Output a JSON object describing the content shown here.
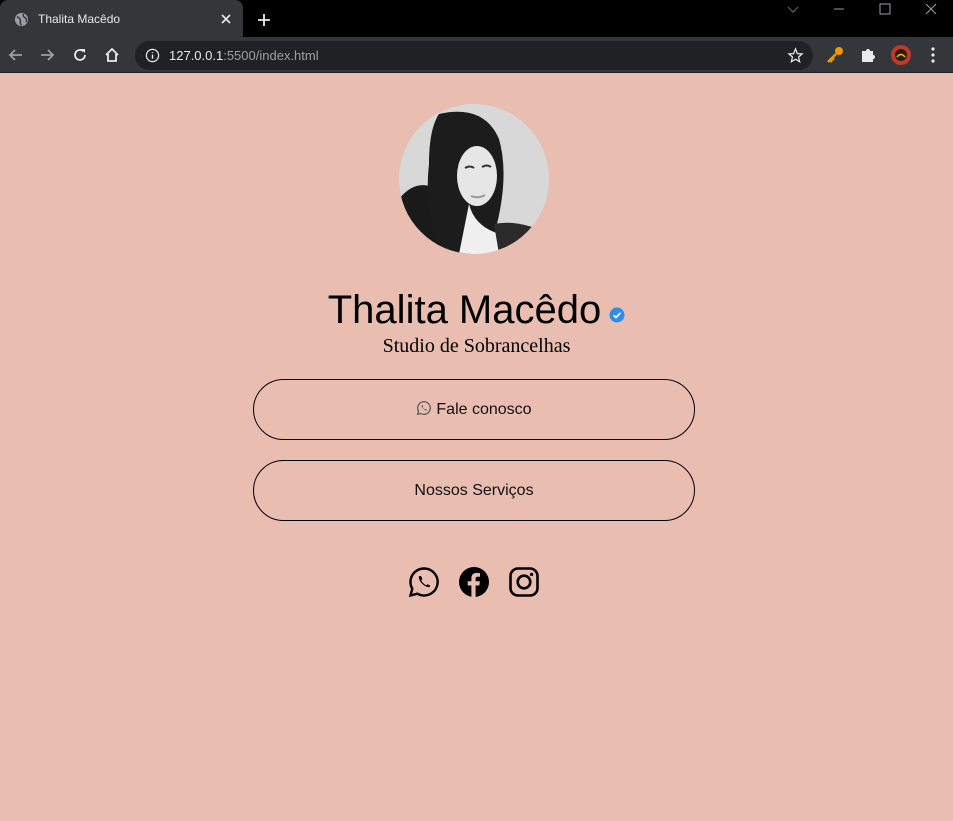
{
  "browser": {
    "tab_title": "Thalita Macêdo",
    "url_host": "127.0.0.1",
    "url_path": ":5500/index.html"
  },
  "profile": {
    "name": "Thalita Macêdo",
    "subtitle": "Studio de Sobrancelhas"
  },
  "buttons": {
    "contact_label": "Fale conosco",
    "services_label": "Nossos Serviços"
  },
  "social_icons": [
    "whatsapp-icon",
    "facebook-icon",
    "instagram-icon"
  ],
  "colors": {
    "page_background": "#e9beb0",
    "verified_badge": "#2d8cf0",
    "text": "#000000"
  }
}
